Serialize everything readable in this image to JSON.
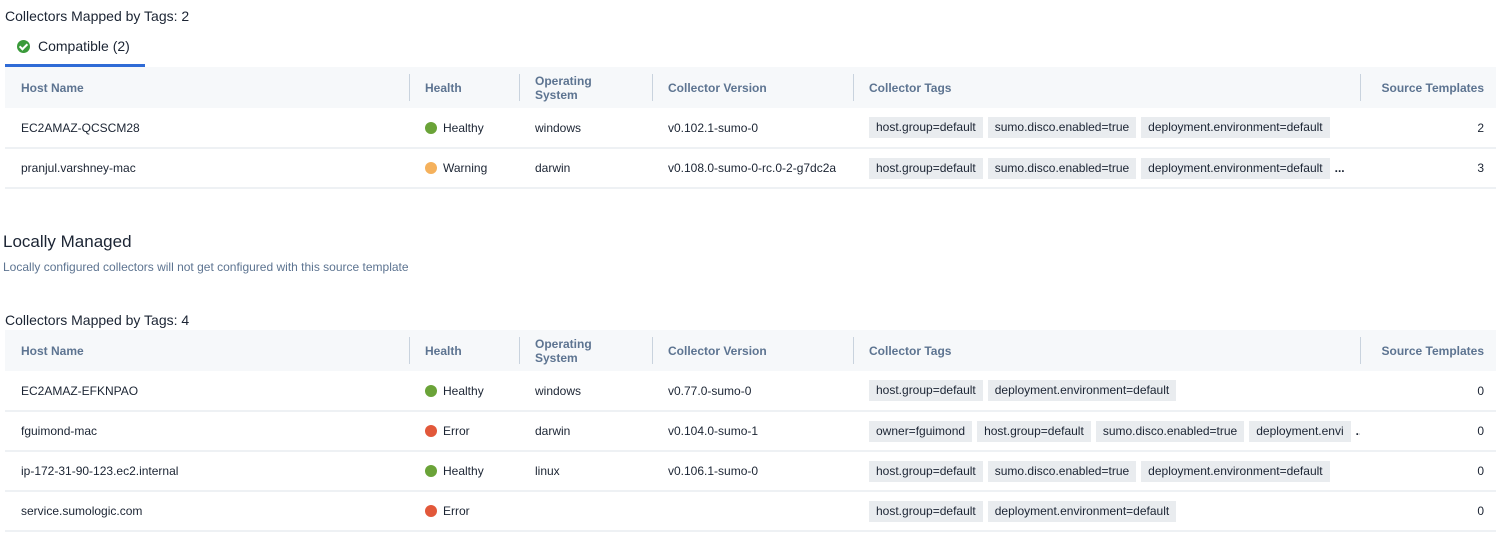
{
  "compatible_section": {
    "title": "Collectors Mapped by Tags: 2",
    "tabs": [
      {
        "label": "Compatible (2)",
        "icon": "check-circle-icon",
        "active": true
      }
    ],
    "columns": [
      "Host Name",
      "Health",
      "Operating System",
      "Collector Version",
      "Collector Tags",
      "Source Templates"
    ],
    "rows": [
      {
        "host": "EC2AMAZ-QCSCM28",
        "health": "Healthy",
        "health_color": "#6aa338",
        "os": "windows",
        "version": "v0.102.1-sumo-0",
        "tags": [
          "host.group=default",
          "sumo.disco.enabled=true",
          "deployment.environment=default"
        ],
        "overflow": "",
        "source_templates": "2"
      },
      {
        "host": "pranjul.varshney-mac",
        "health": "Warning",
        "health_color": "#f5b15c",
        "os": "darwin",
        "version": "v0.108.0-sumo-0-rc.0-2-g7dc2a",
        "tags": [
          "host.group=default",
          "sumo.disco.enabled=true",
          "deployment.environment=default"
        ],
        "overflow": "...",
        "source_templates": "3"
      }
    ]
  },
  "locally_managed": {
    "title": "Locally Managed",
    "description": "Locally configured collectors will not get configured with this source template"
  },
  "local_section": {
    "title": "Collectors Mapped by Tags: 4",
    "columns": [
      "Host Name",
      "Health",
      "Operating System",
      "Collector Version",
      "Collector Tags",
      "Source Templates"
    ],
    "rows": [
      {
        "host": "EC2AMAZ-EFKNPAO",
        "health": "Healthy",
        "health_color": "#6aa338",
        "os": "windows",
        "version": "v0.77.0-sumo-0",
        "tags": [
          "host.group=default",
          "deployment.environment=default"
        ],
        "overflow": "",
        "source_templates": "0"
      },
      {
        "host": "fguimond-mac",
        "health": "Error",
        "health_color": "#e2583a",
        "os": "darwin",
        "version": "v0.104.0-sumo-1",
        "tags": [
          "owner=fguimond",
          "host.group=default",
          "sumo.disco.enabled=true",
          "deployment.envi"
        ],
        "overflow": "...",
        "source_templates": "0"
      },
      {
        "host": "ip-172-31-90-123.ec2.internal",
        "health": "Healthy",
        "health_color": "#6aa338",
        "os": "linux",
        "version": "v0.106.1-sumo-0",
        "tags": [
          "host.group=default",
          "sumo.disco.enabled=true",
          "deployment.environment=default"
        ],
        "overflow": "",
        "source_templates": "0"
      },
      {
        "host": "service.sumologic.com",
        "health": "Error",
        "health_color": "#e2583a",
        "os": "",
        "version": "",
        "tags": [
          "host.group=default",
          "deployment.environment=default"
        ],
        "overflow": "",
        "source_templates": "0"
      }
    ]
  },
  "colors": {
    "tab_underline": "#2f6bd6",
    "header_text": "#5d7491",
    "tag_bg": "#e9ecef"
  }
}
